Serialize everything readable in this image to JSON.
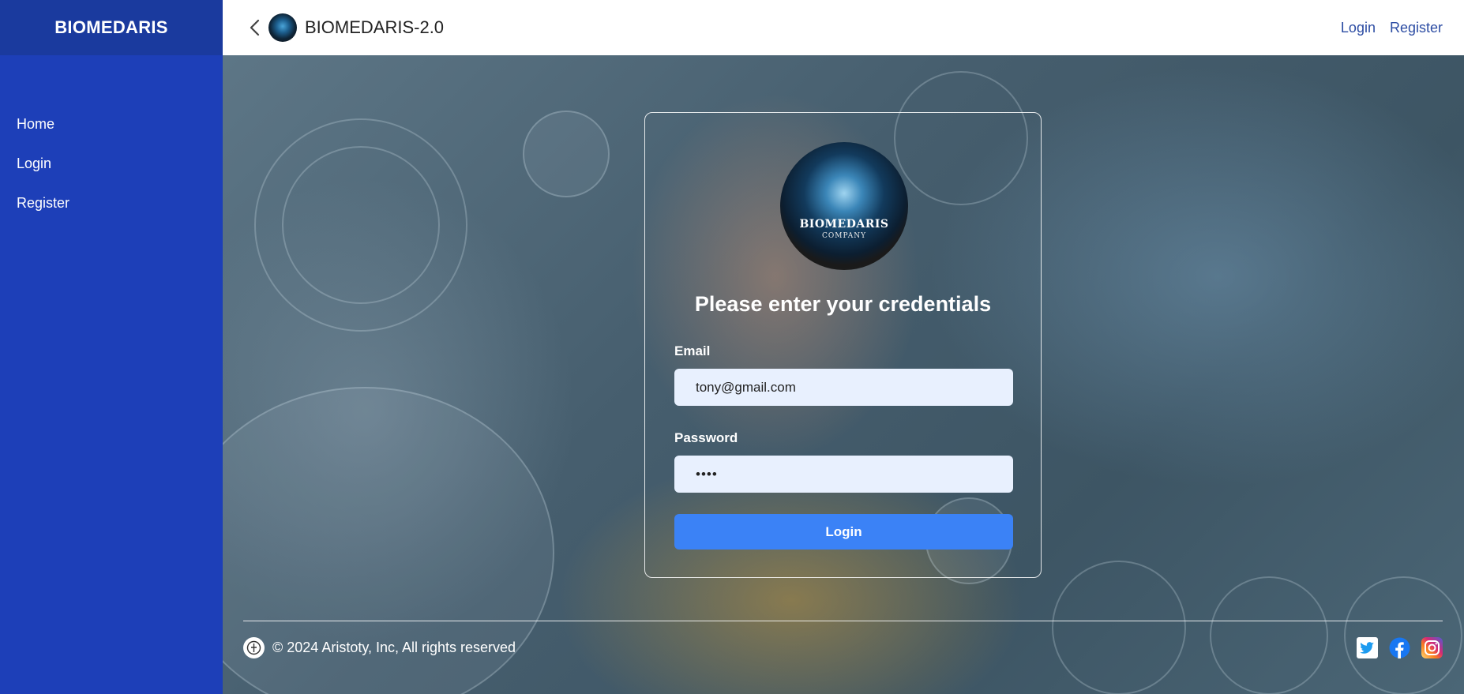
{
  "sidebar": {
    "brand": "BIOMEDARIS",
    "items": [
      {
        "label": "Home"
      },
      {
        "label": "Login"
      },
      {
        "label": "Register"
      }
    ]
  },
  "header": {
    "title": "BIOMEDARIS-2.0",
    "links": {
      "login": "Login",
      "register": "Register"
    }
  },
  "card": {
    "logo_line1": "BIOMEDARIS",
    "logo_line2": "COMPANY",
    "title": "Please enter your credentials",
    "email_label": "Email",
    "email_value": "tony@gmail.com",
    "password_label": "Password",
    "password_value": "••••",
    "login_button": "Login"
  },
  "footer": {
    "copyright": "© 2024 Aristoty, Inc, All rights reserved"
  },
  "icons": {
    "back": "chevron-left-icon",
    "twitter": "twitter-icon",
    "facebook": "facebook-icon",
    "instagram": "instagram-icon"
  },
  "colors": {
    "sidebar": "#1d3fb8",
    "brand_bar": "#1a3a9e",
    "button": "#3b82f6",
    "input_bg": "#e8f0fe",
    "link": "#2c4ca3"
  }
}
